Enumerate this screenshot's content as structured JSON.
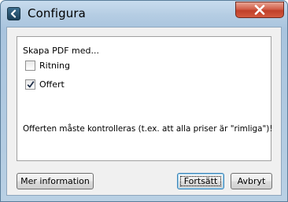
{
  "window": {
    "title": "Configura"
  },
  "group": {
    "heading": "Skapa PDF med...",
    "options": [
      {
        "label": "Ritning",
        "checked": false
      },
      {
        "label": "Offert",
        "checked": true
      }
    ],
    "message": "Offerten måste kontrolleras (t.ex. att alla priser är \"rimliga\")!"
  },
  "buttons": {
    "more_info": "Mer information",
    "continue": "Fortsätt",
    "cancel": "Avbryt"
  },
  "colors": {
    "titlebar": "#b5cde3",
    "close_button": "#c7432c",
    "default_button_border": "#3c7fb1"
  },
  "icons": {
    "app": "back-arrow-icon",
    "close": "close-icon",
    "check": "checkmark-icon"
  }
}
